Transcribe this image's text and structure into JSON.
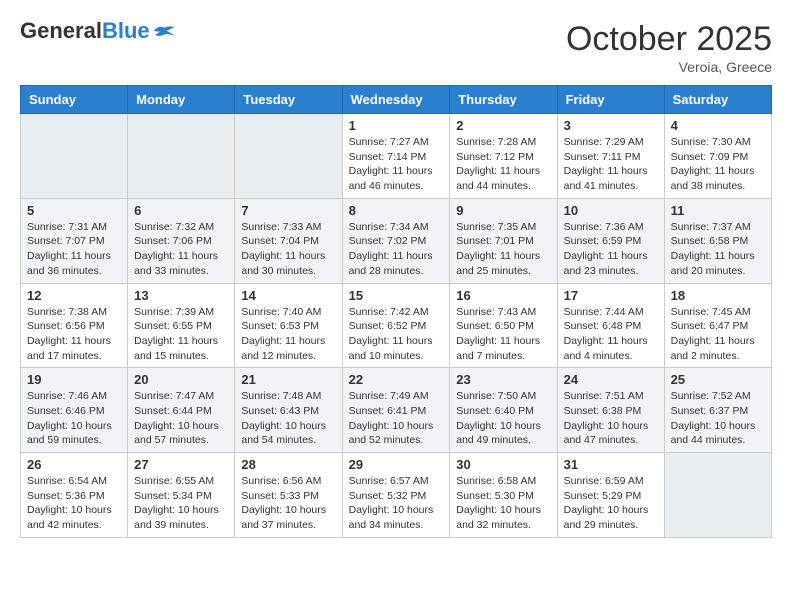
{
  "header": {
    "logo_general": "General",
    "logo_blue": "Blue",
    "month_title": "October 2025",
    "location": "Veroia, Greece"
  },
  "weekdays": [
    "Sunday",
    "Monday",
    "Tuesday",
    "Wednesday",
    "Thursday",
    "Friday",
    "Saturday"
  ],
  "weeks": [
    [
      {
        "day": "",
        "info": ""
      },
      {
        "day": "",
        "info": ""
      },
      {
        "day": "",
        "info": ""
      },
      {
        "day": "1",
        "info": "Sunrise: 7:27 AM\nSunset: 7:14 PM\nDaylight: 11 hours\nand 46 minutes."
      },
      {
        "day": "2",
        "info": "Sunrise: 7:28 AM\nSunset: 7:12 PM\nDaylight: 11 hours\nand 44 minutes."
      },
      {
        "day": "3",
        "info": "Sunrise: 7:29 AM\nSunset: 7:11 PM\nDaylight: 11 hours\nand 41 minutes."
      },
      {
        "day": "4",
        "info": "Sunrise: 7:30 AM\nSunset: 7:09 PM\nDaylight: 11 hours\nand 38 minutes."
      }
    ],
    [
      {
        "day": "5",
        "info": "Sunrise: 7:31 AM\nSunset: 7:07 PM\nDaylight: 11 hours\nand 36 minutes."
      },
      {
        "day": "6",
        "info": "Sunrise: 7:32 AM\nSunset: 7:06 PM\nDaylight: 11 hours\nand 33 minutes."
      },
      {
        "day": "7",
        "info": "Sunrise: 7:33 AM\nSunset: 7:04 PM\nDaylight: 11 hours\nand 30 minutes."
      },
      {
        "day": "8",
        "info": "Sunrise: 7:34 AM\nSunset: 7:02 PM\nDaylight: 11 hours\nand 28 minutes."
      },
      {
        "day": "9",
        "info": "Sunrise: 7:35 AM\nSunset: 7:01 PM\nDaylight: 11 hours\nand 25 minutes."
      },
      {
        "day": "10",
        "info": "Sunrise: 7:36 AM\nSunset: 6:59 PM\nDaylight: 11 hours\nand 23 minutes."
      },
      {
        "day": "11",
        "info": "Sunrise: 7:37 AM\nSunset: 6:58 PM\nDaylight: 11 hours\nand 20 minutes."
      }
    ],
    [
      {
        "day": "12",
        "info": "Sunrise: 7:38 AM\nSunset: 6:56 PM\nDaylight: 11 hours\nand 17 minutes."
      },
      {
        "day": "13",
        "info": "Sunrise: 7:39 AM\nSunset: 6:55 PM\nDaylight: 11 hours\nand 15 minutes."
      },
      {
        "day": "14",
        "info": "Sunrise: 7:40 AM\nSunset: 6:53 PM\nDaylight: 11 hours\nand 12 minutes."
      },
      {
        "day": "15",
        "info": "Sunrise: 7:42 AM\nSunset: 6:52 PM\nDaylight: 11 hours\nand 10 minutes."
      },
      {
        "day": "16",
        "info": "Sunrise: 7:43 AM\nSunset: 6:50 PM\nDaylight: 11 hours\nand 7 minutes."
      },
      {
        "day": "17",
        "info": "Sunrise: 7:44 AM\nSunset: 6:48 PM\nDaylight: 11 hours\nand 4 minutes."
      },
      {
        "day": "18",
        "info": "Sunrise: 7:45 AM\nSunset: 6:47 PM\nDaylight: 11 hours\nand 2 minutes."
      }
    ],
    [
      {
        "day": "19",
        "info": "Sunrise: 7:46 AM\nSunset: 6:46 PM\nDaylight: 10 hours\nand 59 minutes."
      },
      {
        "day": "20",
        "info": "Sunrise: 7:47 AM\nSunset: 6:44 PM\nDaylight: 10 hours\nand 57 minutes."
      },
      {
        "day": "21",
        "info": "Sunrise: 7:48 AM\nSunset: 6:43 PM\nDaylight: 10 hours\nand 54 minutes."
      },
      {
        "day": "22",
        "info": "Sunrise: 7:49 AM\nSunset: 6:41 PM\nDaylight: 10 hours\nand 52 minutes."
      },
      {
        "day": "23",
        "info": "Sunrise: 7:50 AM\nSunset: 6:40 PM\nDaylight: 10 hours\nand 49 minutes."
      },
      {
        "day": "24",
        "info": "Sunrise: 7:51 AM\nSunset: 6:38 PM\nDaylight: 10 hours\nand 47 minutes."
      },
      {
        "day": "25",
        "info": "Sunrise: 7:52 AM\nSunset: 6:37 PM\nDaylight: 10 hours\nand 44 minutes."
      }
    ],
    [
      {
        "day": "26",
        "info": "Sunrise: 6:54 AM\nSunset: 5:36 PM\nDaylight: 10 hours\nand 42 minutes."
      },
      {
        "day": "27",
        "info": "Sunrise: 6:55 AM\nSunset: 5:34 PM\nDaylight: 10 hours\nand 39 minutes."
      },
      {
        "day": "28",
        "info": "Sunrise: 6:56 AM\nSunset: 5:33 PM\nDaylight: 10 hours\nand 37 minutes."
      },
      {
        "day": "29",
        "info": "Sunrise: 6:57 AM\nSunset: 5:32 PM\nDaylight: 10 hours\nand 34 minutes."
      },
      {
        "day": "30",
        "info": "Sunrise: 6:58 AM\nSunset: 5:30 PM\nDaylight: 10 hours\nand 32 minutes."
      },
      {
        "day": "31",
        "info": "Sunrise: 6:59 AM\nSunset: 5:29 PM\nDaylight: 10 hours\nand 29 minutes."
      },
      {
        "day": "",
        "info": ""
      }
    ]
  ]
}
